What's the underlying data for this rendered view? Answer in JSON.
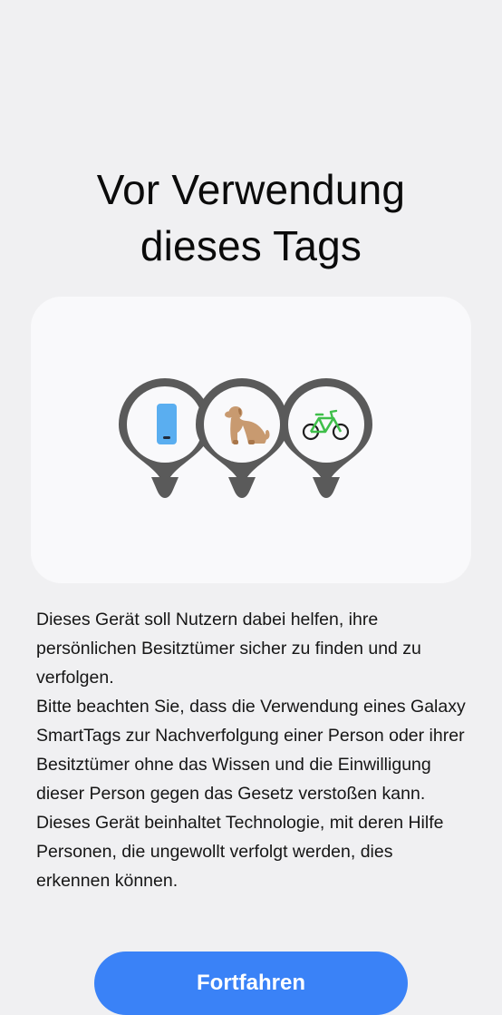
{
  "page": {
    "title_line1": "Vor Verwendung",
    "title_line2": "dieses Tags"
  },
  "illustration": {
    "icons": [
      "phone-icon",
      "dog-icon",
      "bicycle-icon"
    ],
    "colors": {
      "pin": "#5a5a5a",
      "phone": "#5aaef0",
      "dog": "#c89a70",
      "bicycle": "#3fbf4a"
    }
  },
  "description": {
    "paragraph1": "Dieses Gerät soll Nutzern dabei helfen, ihre persönlichen Besitztümer sicher zu finden und zu verfolgen.",
    "paragraph2": "Bitte beachten Sie, dass die Verwendung eines Galaxy SmartTags zur Nachverfolgung einer Person oder ihrer Besitztümer ohne das Wissen und die Einwilligung dieser Person gegen das Gesetz verstoßen kann.",
    "paragraph3": "Dieses Gerät beinhaltet Technologie, mit deren Hilfe Personen, die ungewollt verfolgt werden, dies erkennen können."
  },
  "actions": {
    "continue_label": "Fortfahren",
    "accent_color": "#3a82f7"
  }
}
